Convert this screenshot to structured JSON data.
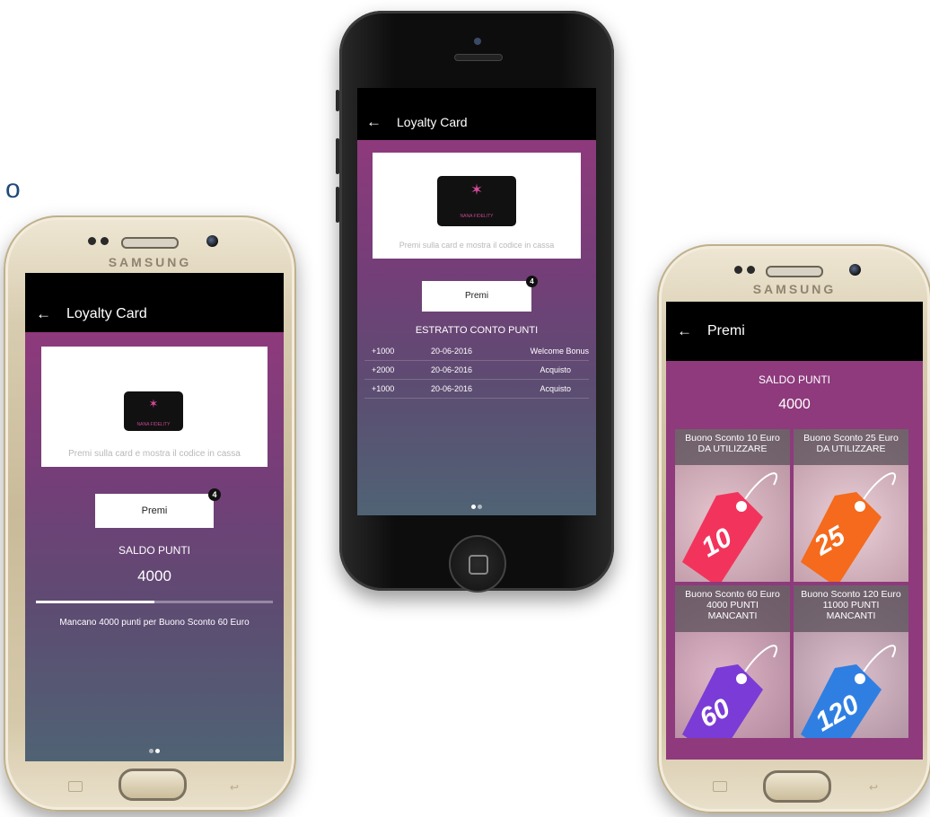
{
  "stray_glyph": "o",
  "device_brand": "SAMSUNG",
  "left_screen": {
    "title": "Loyalty Card",
    "back_icon": "arrow-left-icon",
    "card": {
      "name": "NANA FIDELITY",
      "hint": "Premi sulla card e mostra il codice in cassa"
    },
    "rewards_button": {
      "label": "Premi",
      "badge": "4"
    },
    "balance": {
      "label": "SALDO PUNTI",
      "value": "4000"
    },
    "progress_fraction": 0.5,
    "progress_text": "Mancano 4000 punti per Buono Sconto 60 Euro",
    "page_dots": {
      "count": 2,
      "active": 1
    }
  },
  "center_screen": {
    "title": "Loyalty Card",
    "back_icon": "arrow-left-icon",
    "card": {
      "name": "NANA FIDELITY",
      "hint": "Premi sulla card e mostra il codice in cassa"
    },
    "rewards_button": {
      "label": "Premi",
      "badge": "4"
    },
    "statement_title": "ESTRATTO CONTO PUNTI",
    "statement": [
      {
        "points": "+1000",
        "date": "20-06-2016",
        "description": "Welcome Bonus"
      },
      {
        "points": "+2000",
        "date": "20-06-2016",
        "description": "Acquisto"
      },
      {
        "points": "+1000",
        "date": "20-06-2016",
        "description": "Acquisto"
      }
    ],
    "page_dots": {
      "count": 2,
      "active": 0
    }
  },
  "right_screen": {
    "title": "Premi",
    "back_icon": "arrow-left-icon",
    "balance": {
      "label": "SALDO PUNTI",
      "value": "4000"
    },
    "rewards": [
      {
        "line1": "Buono Sconto 10 Euro",
        "line2": "DA UTILIZZARE",
        "line3": "",
        "tag_text": "10",
        "tag_color": "#f2345c"
      },
      {
        "line1": "Buono Sconto 25 Euro",
        "line2": "DA UTILIZZARE",
        "line3": "",
        "tag_text": "25",
        "tag_color": "#f56a1c"
      },
      {
        "line1": "Buono Sconto 60 Euro",
        "line2": "4000 PUNTI",
        "line3": "MANCANTI",
        "tag_text": "60",
        "tag_color": "#7b3bd6"
      },
      {
        "line1": "Buono Sconto 120 Euro",
        "line2": "11000 PUNTI",
        "line3": "MANCANTI",
        "tag_text": "120",
        "tag_color": "#2f7fe3"
      }
    ]
  },
  "colors": {
    "gradient_top": "#8e3a7c",
    "gradient_bottom": "#4f6374",
    "appbar": "#000000",
    "badge": "#111111"
  }
}
